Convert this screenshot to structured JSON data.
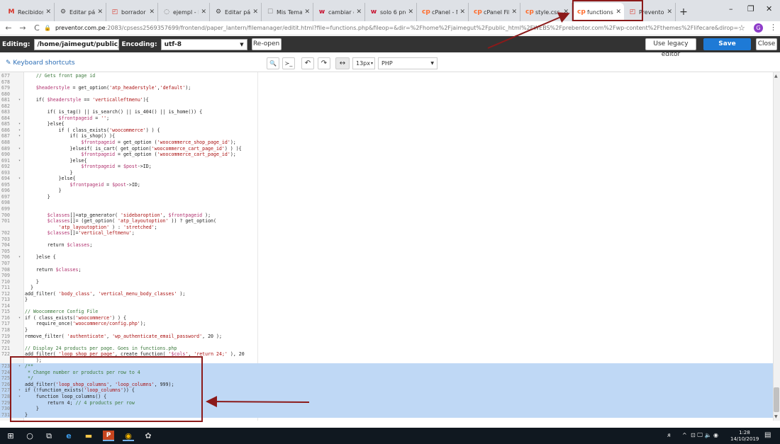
{
  "browser": {
    "tabs": [
      {
        "label": "Recibidos (",
        "favicon": "M",
        "color": "#d93025"
      },
      {
        "label": "Editar págin",
        "favicon": "⚙",
        "color": "#444"
      },
      {
        "label": "borrador -",
        "favicon": "◰",
        "color": "#d93025"
      },
      {
        "label": "ejempl - Pl",
        "favicon": "◌",
        "color": "#666"
      },
      {
        "label": "Editar págin",
        "favicon": "⚙",
        "color": "#444"
      },
      {
        "label": "Mis Temas",
        "favicon": "☐",
        "color": "#888"
      },
      {
        "label": "cambiar de",
        "favicon": "w",
        "color": "#c7102e"
      },
      {
        "label": "solo 6 prod",
        "favicon": "w",
        "color": "#c7102e"
      },
      {
        "label": "cPanel - Ma",
        "favicon": "cp",
        "color": "#ff6c2c"
      },
      {
        "label": "cPanel File",
        "favicon": "cp",
        "color": "#ff6c2c"
      },
      {
        "label": "style.css - c",
        "favicon": "cp",
        "color": "#ff6c2c"
      },
      {
        "label": "functions.p",
        "favicon": "cp",
        "color": "#ff6c2c",
        "active": true
      },
      {
        "label": "Preventor -",
        "favicon": "◰",
        "color": "#d93025"
      }
    ],
    "new_tab": "+",
    "window_controls": {
      "minimize": "–",
      "maximize": "❐",
      "close": "✕"
    },
    "nav": {
      "back": "←",
      "forward": "→",
      "reload": "C"
    },
    "url_host": "preventor.com.pe",
    "url_path": ":2083/cpsess2569357699/frontend/paper_lantern/filemanager/editit.html?file=functions.php&fileop=&dir=%2Fhome%2Fjaimegut%2Fpublic_html%2FWEBS%2Fprebentor.com%2Fwp-content%2Fthemes%2Flifecare&dirop=&charset=&file_charset=_D...",
    "lock": "🔒",
    "star": "☆",
    "avatar_letter": "G",
    "menu": "⋮"
  },
  "editor_bar": {
    "editing_label": "Editing:",
    "path_value": "/home/jaimegut/public_ht",
    "encoding_label": "Encoding:",
    "encoding_value": "utf-8",
    "reopen_label": "Re-open",
    "legacy_label": "Use legacy editor",
    "save_label": "Save Changes",
    "close_label": "Close"
  },
  "toolbar": {
    "keyboard_shortcuts": "Keyboard shortcuts",
    "keyboard_icon": "✎",
    "search_icon": "🔍",
    "terminal_icon": "≻_",
    "undo_icon": "↶",
    "redo_icon": "↷",
    "wrap_icon": "↔",
    "font_size": "13px",
    "language": "PHP"
  },
  "code_lines": [
    {
      "n": "677",
      "f": "",
      "t": "    // Gets front page id",
      "sel": false
    },
    {
      "n": "678",
      "f": "",
      "t": "",
      "sel": false
    },
    {
      "n": "679",
      "f": "",
      "t": "    $headerstyle = get_option('atp_headerstyle','default');",
      "sel": false
    },
    {
      "n": "680",
      "f": "",
      "t": "",
      "sel": false
    },
    {
      "n": "681",
      "f": "▾",
      "t": "    if( $headerstyle == 'verticalleftmenu'){",
      "sel": false
    },
    {
      "n": "682",
      "f": "",
      "t": "",
      "sel": false
    },
    {
      "n": "683",
      "f": "",
      "t": "        if( is_tag() || is_search() || is_404() || is_home()) {",
      "sel": false
    },
    {
      "n": "684",
      "f": "",
      "t": "            $frontpageid = '';",
      "sel": false
    },
    {
      "n": "685",
      "f": "▾",
      "t": "        }else{",
      "sel": false
    },
    {
      "n": "686",
      "f": "▾",
      "t": "            if ( class_exists('woocommerce') ) {",
      "sel": false
    },
    {
      "n": "687",
      "f": "▾",
      "t": "                if( is_shop() ){",
      "sel": false
    },
    {
      "n": "688",
      "f": "",
      "t": "                    $frontpageid = get_option ('woocommerce_shop_page_id');",
      "sel": false
    },
    {
      "n": "689",
      "f": "▾",
      "t": "                }elseif( is_cart( get_option('woocommerce_cart_page_id') ) ){",
      "sel": false
    },
    {
      "n": "690",
      "f": "",
      "t": "                    $frontpageid = get_option ('woocommerce_cart_page_id');",
      "sel": false
    },
    {
      "n": "691",
      "f": "▾",
      "t": "                }else{",
      "sel": false
    },
    {
      "n": "692",
      "f": "",
      "t": "                    $frontpageid = $post->ID;",
      "sel": false
    },
    {
      "n": "693",
      "f": "",
      "t": "                }",
      "sel": false
    },
    {
      "n": "694",
      "f": "▾",
      "t": "            }else{",
      "sel": false
    },
    {
      "n": "695",
      "f": "",
      "t": "                $frontpageid = $post->ID;",
      "sel": false
    },
    {
      "n": "696",
      "f": "",
      "t": "            }",
      "sel": false
    },
    {
      "n": "697",
      "f": "",
      "t": "        }",
      "sel": false
    },
    {
      "n": "698",
      "f": "",
      "t": "",
      "sel": false
    },
    {
      "n": "699",
      "f": "",
      "t": "",
      "sel": false
    },
    {
      "n": "700",
      "f": "",
      "t": "        $classes[]=atp_generator( 'sidebaroption', $frontpageid );",
      "sel": false
    },
    {
      "n": "701",
      "f": "",
      "t": "        $classes[]= (get_option( 'atp_layoutoption' )) ? get_option(",
      "sel": false
    },
    {
      "n": "",
      "f": "",
      "t": "            'atp_layoutoption' ) : 'stretched';",
      "sel": false
    },
    {
      "n": "702",
      "f": "",
      "t": "        $classes[]='vertical_leftmenu';",
      "sel": false
    },
    {
      "n": "703",
      "f": "",
      "t": "",
      "sel": false
    },
    {
      "n": "704",
      "f": "",
      "t": "        return $classes;",
      "sel": false
    },
    {
      "n": "705",
      "f": "",
      "t": "",
      "sel": false
    },
    {
      "n": "706",
      "f": "▾",
      "t": "    }else {",
      "sel": false
    },
    {
      "n": "707",
      "f": "",
      "t": "",
      "sel": false
    },
    {
      "n": "708",
      "f": "",
      "t": "    return $classes;",
      "sel": false
    },
    {
      "n": "709",
      "f": "",
      "t": "",
      "sel": false
    },
    {
      "n": "710",
      "f": "",
      "t": "    }",
      "sel": false
    },
    {
      "n": "711",
      "f": "",
      "t": "  }",
      "sel": false
    },
    {
      "n": "712",
      "f": "",
      "t": "add_filter( 'body_class', 'vertical_menu_body_classes' );",
      "sel": false
    },
    {
      "n": "713",
      "f": "",
      "t": "}",
      "sel": false
    },
    {
      "n": "714",
      "f": "",
      "t": "",
      "sel": false
    },
    {
      "n": "715",
      "f": "",
      "t": "// Woocommerce Config File",
      "sel": false
    },
    {
      "n": "716",
      "f": "▾",
      "t": "if ( class_exists('woocommerce') ) {",
      "sel": false
    },
    {
      "n": "717",
      "f": "",
      "t": "    require_once('woocommerce/config.php');",
      "sel": false
    },
    {
      "n": "718",
      "f": "",
      "t": "}",
      "sel": false
    },
    {
      "n": "719",
      "f": "",
      "t": "remove_filter( 'authenticate', 'wp_authenticate_email_password', 20 );",
      "sel": false
    },
    {
      "n": "720",
      "f": "",
      "t": "",
      "sel": false
    },
    {
      "n": "721",
      "f": "",
      "t": "// Display 24 products per page. Goes in functions.php",
      "sel": false
    },
    {
      "n": "722",
      "f": "",
      "t": "add_filter( 'loop_shop_per_page', create_function( '$cols', 'return 24;' ), 20",
      "sel": false
    },
    {
      "n": "",
      "f": "",
      "t": "    );",
      "sel": false
    },
    {
      "n": "723",
      "f": "▾",
      "t": "/**",
      "sel": true
    },
    {
      "n": "724",
      "f": "",
      "t": " * Change number or products per row to 4",
      "sel": true
    },
    {
      "n": "725",
      "f": "",
      "t": " */",
      "sel": true
    },
    {
      "n": "726",
      "f": "",
      "t": "add_filter('loop_shop_columns', 'loop_columns', 999);",
      "sel": true
    },
    {
      "n": "727",
      "f": "▾",
      "t": "if (!function_exists('loop_columns')) {",
      "sel": true
    },
    {
      "n": "728",
      "f": "▾",
      "t": "    function loop_columns() {",
      "sel": true
    },
    {
      "n": "729",
      "f": "",
      "t": "        return 4; // 4 products per row",
      "sel": true
    },
    {
      "n": "730",
      "f": "",
      "t": "    }",
      "sel": true
    },
    {
      "n": "731",
      "f": "",
      "t": "}",
      "sel": true
    }
  ],
  "taskbar": {
    "start": "⊞",
    "search": "○",
    "taskview": "⧉",
    "edge": "e",
    "explorer": "▬",
    "powerpoint": "P",
    "chrome": "◉",
    "other": "✿",
    "tray_person": "ᴙ",
    "tray_chevron": "^",
    "tray_icons": "⊡ 🖵 🔈 ◉",
    "time": "1:28",
    "date": "14/10/2019",
    "notification": "▤"
  },
  "colors": {
    "accent_save": "#1e7ad6",
    "editor_bar": "#333333",
    "selection": "#bfd8f5",
    "annotation": "#8b1a1a"
  }
}
